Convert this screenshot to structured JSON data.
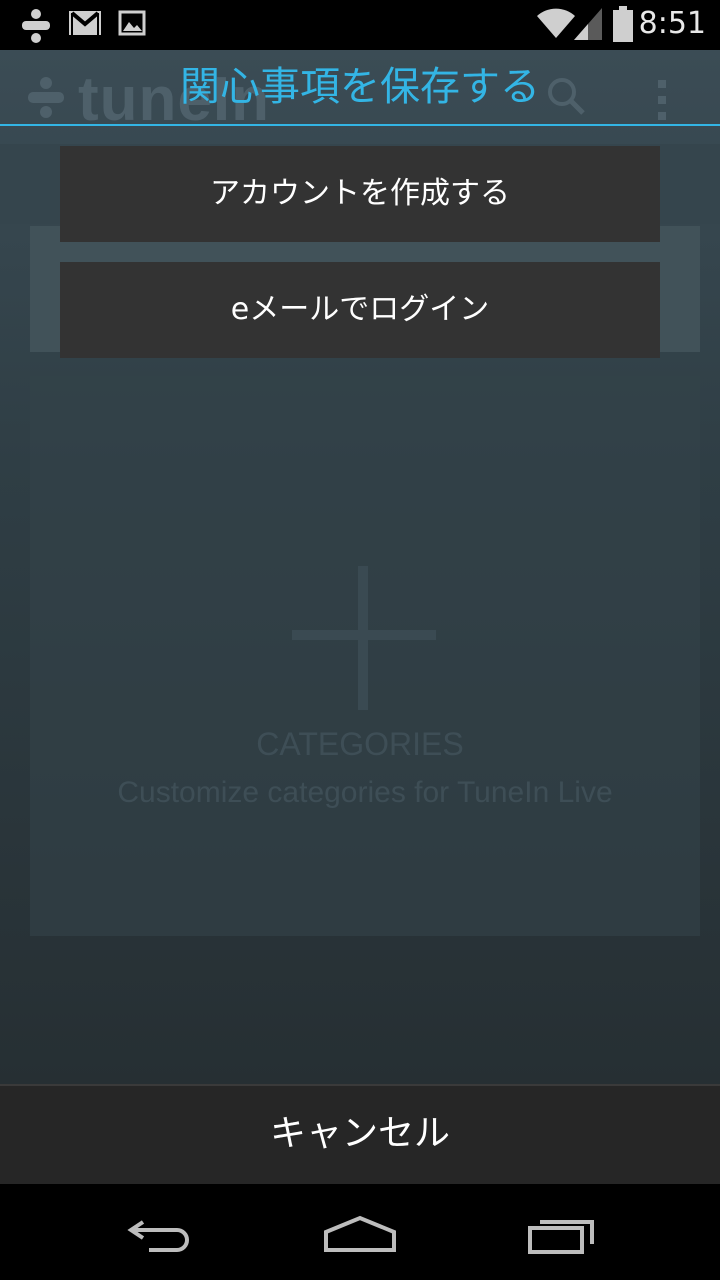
{
  "status_bar": {
    "time": "8:51",
    "icons": [
      "tunein-notification-icon",
      "gmail-icon",
      "image-icon",
      "wifi-icon",
      "signal-icon",
      "battery-icon"
    ]
  },
  "background_app": {
    "logo_text": "tuneIn",
    "card": {
      "title": "CATEGORIES",
      "description": "Customize categories for TuneIn Live"
    }
  },
  "dialog": {
    "title": "関心事項を保存する",
    "buttons": {
      "create_account": "アカウントを作成する",
      "email_login": "eメールでログイン"
    },
    "cancel_label": "キャンセル"
  },
  "colors": {
    "accent": "#33b5e5",
    "button_bg": "#333333",
    "cancel_bg": "#262626"
  },
  "navigation_bar": {
    "icons": [
      "back-icon",
      "home-icon",
      "recent-apps-icon"
    ]
  }
}
